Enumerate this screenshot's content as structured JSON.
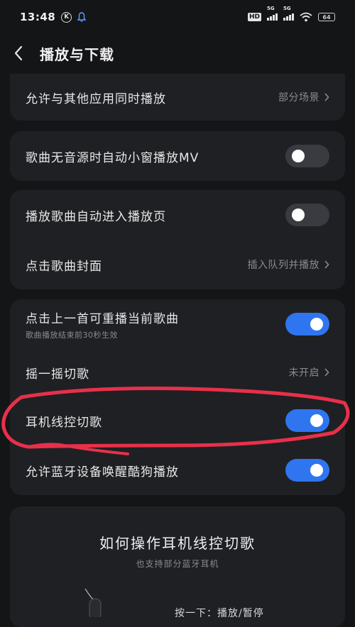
{
  "status_bar": {
    "time": "13:48",
    "k_label": "K",
    "hd_label": "HD",
    "signal1_label": "5G",
    "signal2_label": "5G",
    "battery": "64"
  },
  "header": {
    "back_icon": "chevron-left-icon",
    "title": "播放与下载"
  },
  "settings": {
    "allow_simultaneous": {
      "label": "允许与其他应用同时播放",
      "value": "部分场景"
    },
    "auto_mini_mv": {
      "label": "歌曲无音源时自动小窗播放MV",
      "state": "off"
    },
    "auto_enter_player": {
      "label": "播放歌曲自动进入播放页",
      "state": "off"
    },
    "tap_cover": {
      "label": "点击歌曲封面",
      "value": "插入队列并播放"
    },
    "replay_prev": {
      "label": "点击上一首可重播当前歌曲",
      "sub": "歌曲播放结束前30秒生效",
      "state": "on"
    },
    "shake_switch": {
      "label": "摇一摇切歌",
      "value": "未开启"
    },
    "earphone_control": {
      "label": "耳机线控切歌",
      "state": "on"
    },
    "bluetooth_wake": {
      "label": "允许蓝牙设备唤醒酷狗播放",
      "state": "on"
    }
  },
  "howto": {
    "title": "如何操作耳机线控切歌",
    "subtitle": "也支持部分蓝牙耳机",
    "hint": "按一下：播放/暂停"
  },
  "colors": {
    "background": "#141517",
    "card": "#1f2023",
    "toggle_on": "#2f75f0",
    "toggle_off": "#3a3b40",
    "annotation": "#e8304a"
  }
}
